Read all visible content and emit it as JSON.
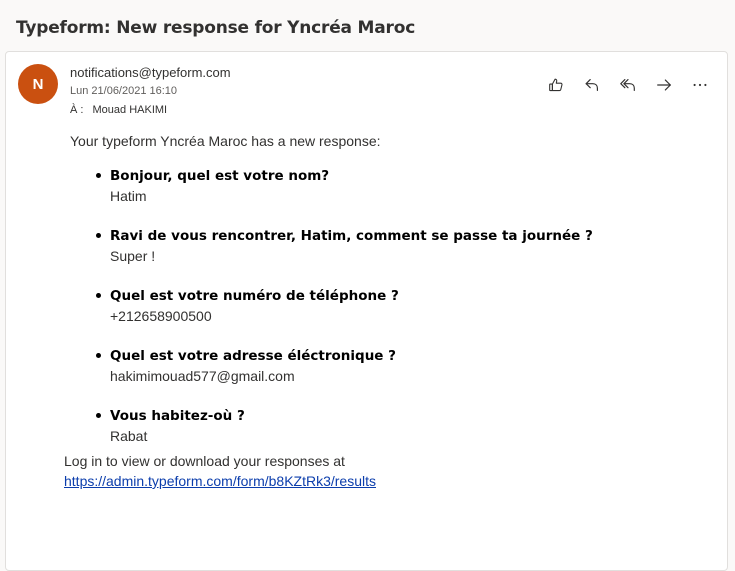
{
  "email": {
    "subject": "Typeform: New response for Yncréa Maroc",
    "avatar_initial": "N",
    "avatar_color": "#ca5010",
    "from": "notifications@typeform.com",
    "date": "Lun 21/06/2021 16:10",
    "to_label": "À :",
    "to_name": "Mouad HAKIMI",
    "actions": [
      {
        "name": "like-icon",
        "label": "Like"
      },
      {
        "name": "reply-icon",
        "label": "Reply"
      },
      {
        "name": "reply-all-icon",
        "label": "Reply all"
      },
      {
        "name": "forward-icon",
        "label": "Forward"
      },
      {
        "name": "more-icon",
        "label": "More actions"
      }
    ],
    "intro": "Your typeform Yncréa Maroc has a new response:",
    "qa": [
      {
        "q": "Bonjour, quel est votre nom?",
        "a": "Hatim"
      },
      {
        "q": "Ravi de vous rencontrer, Hatim, comment se passe ta journée ?",
        "a": "Super !"
      },
      {
        "q": "Quel est votre numéro de téléphone ?",
        "a": "+212658900500"
      },
      {
        "q": "Quel est votre adresse éléctronique ?",
        "a": "hakimimouad577@gmail.com"
      },
      {
        "q": "Vous habitez-où ?",
        "a": "Rabat"
      }
    ],
    "footer_text": "Log in to view or download your responses at",
    "footer_link": "https://admin.typeform.com/form/b8KZtRk3/results"
  }
}
